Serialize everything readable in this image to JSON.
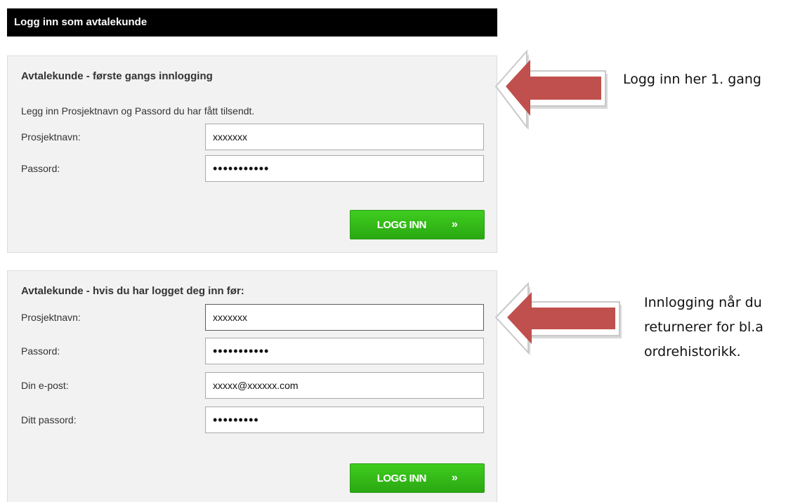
{
  "header": {
    "title": "Logg inn som avtalekunde"
  },
  "first_login": {
    "title": "Avtalekunde - første gangs innlogging",
    "description": "Legg inn Prosjektnavn og Passord du har fått tilsendt.",
    "project_label": "Prosjektnavn:",
    "project_value": "xxxxxxx",
    "password_label": "Passord:",
    "password_value": "•••••••••••",
    "button_label": "LOGG INN",
    "button_icon": "»"
  },
  "returning_login": {
    "title": "Avtalekunde - hvis du har logget deg inn før:",
    "project_label": "Prosjektnavn:",
    "project_value": "xxxxxxx",
    "password_label": "Passord:",
    "password_value": "•••••••••••",
    "email_label": "Din e-post:",
    "email_value": "xxxxx@xxxxxx.com",
    "user_password_label": "Ditt passord:",
    "user_password_value": "•••••••••",
    "button_label": "LOGG INN",
    "button_icon": "»"
  },
  "annotations": {
    "first": "Logg inn her 1. gang",
    "returning_line1": "Innlogging når du",
    "returning_line2": "returnerer for bl.a",
    "returning_line3": "ordrehistorikk."
  },
  "colors": {
    "button_green": "#2fb716",
    "arrow_red": "#c0504d",
    "header_black": "#000000",
    "panel_gray": "#f2f2f2"
  }
}
